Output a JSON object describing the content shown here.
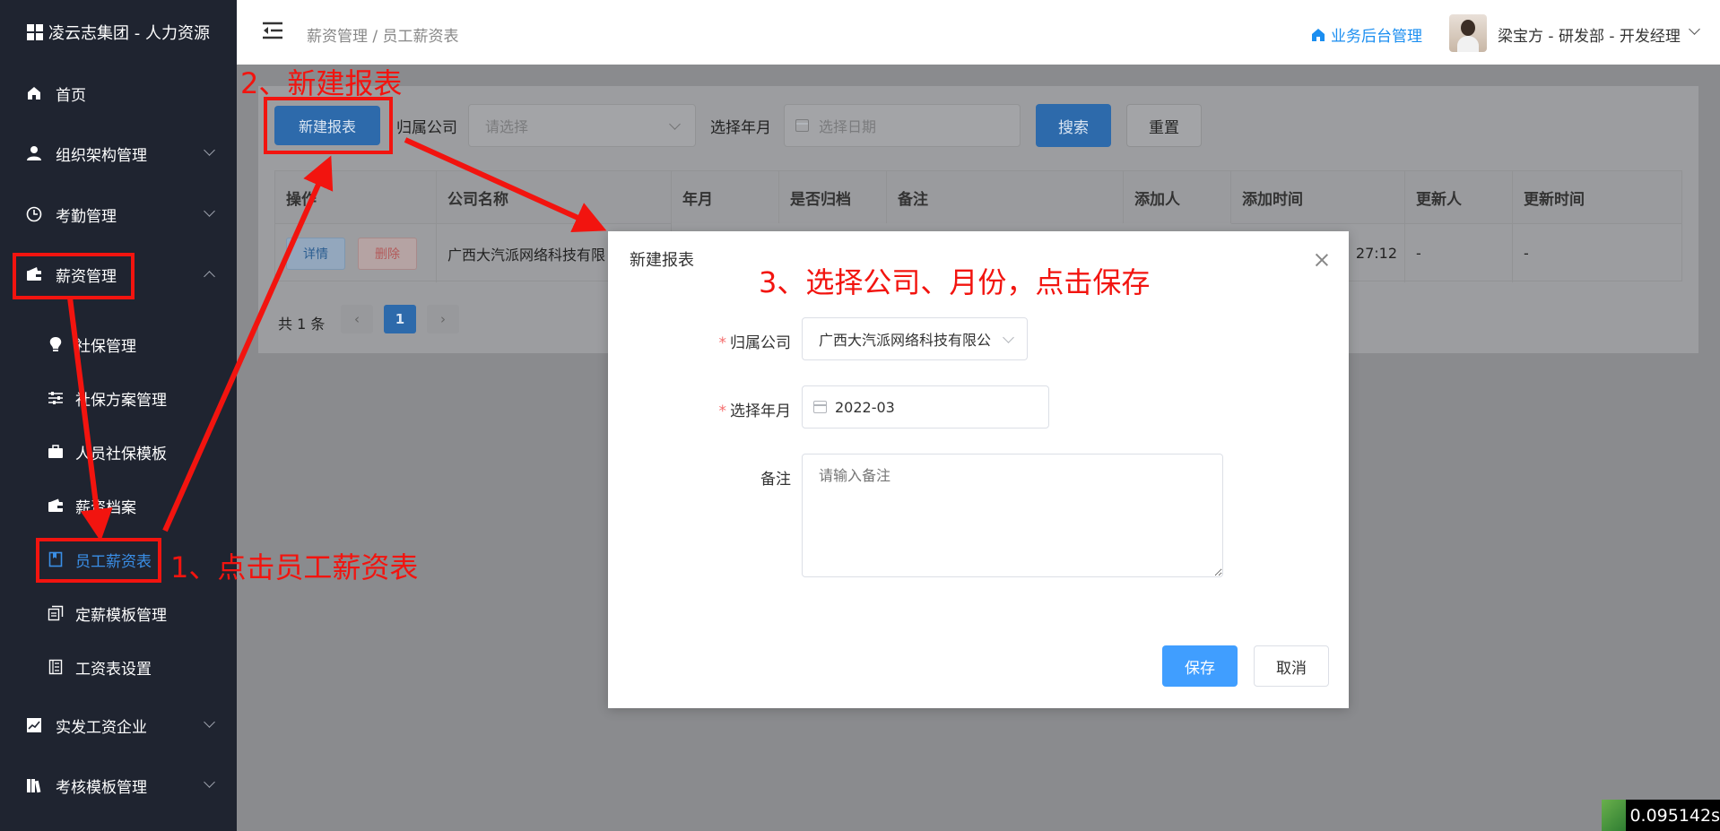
{
  "sidebar": {
    "logo_text": "凌云志集团 - 人力资源",
    "items": [
      {
        "label": "首页"
      },
      {
        "label": "组织架构管理"
      },
      {
        "label": "考勤管理"
      },
      {
        "label": "薪资管理"
      },
      {
        "label": "实发工资企业"
      },
      {
        "label": "考核模板管理"
      }
    ],
    "sub_items": [
      {
        "label": "社保管理"
      },
      {
        "label": "社保方案管理"
      },
      {
        "label": "人员社保模板"
      },
      {
        "label": "薪资档案"
      },
      {
        "label": "员工薪资表"
      },
      {
        "label": "定薪模板管理"
      },
      {
        "label": "工资表设置"
      }
    ]
  },
  "header": {
    "breadcrumb": "薪资管理 / 员工薪资表",
    "biz_link": "业务后台管理",
    "user": "梁宝方 - 研发部 - 开发经理"
  },
  "content": {
    "new_button": "新建报表",
    "company_label": "归属公司",
    "company_placeholder": "请选择",
    "month_label": "选择年月",
    "month_placeholder": "选择日期",
    "search_button": "搜索",
    "reset_button": "重置",
    "columns": [
      "操作",
      "公司名称",
      "年月",
      "是否归档",
      "备注",
      "添加人",
      "添加时间",
      "更新人",
      "更新时间"
    ],
    "row": {
      "detail": "详情",
      "delete": "删除",
      "company": "广西大汽派网络科技有限",
      "add_time": "27:12",
      "updater": "-",
      "update_time": "-"
    },
    "total": "共 1 条",
    "page": "1"
  },
  "modal": {
    "title": "新建报表",
    "company_label": "归属公司",
    "company_value": "广西大汽派网络科技有限公",
    "month_label": "选择年月",
    "month_value": "2022-03",
    "remark_label": "备注",
    "remark_placeholder": "请输入备注",
    "save": "保存",
    "cancel": "取消"
  },
  "annotations": {
    "step1": "1、点击员工薪资表",
    "step2": "2、新建报表",
    "step3": "3、选择公司、月份，点击保存"
  },
  "timer": "0.095142s",
  "colors": {
    "sidebar_bg": "#1f2430",
    "primary": "#409eff",
    "annotation": "#f2140f",
    "link": "#1b8ef0"
  }
}
